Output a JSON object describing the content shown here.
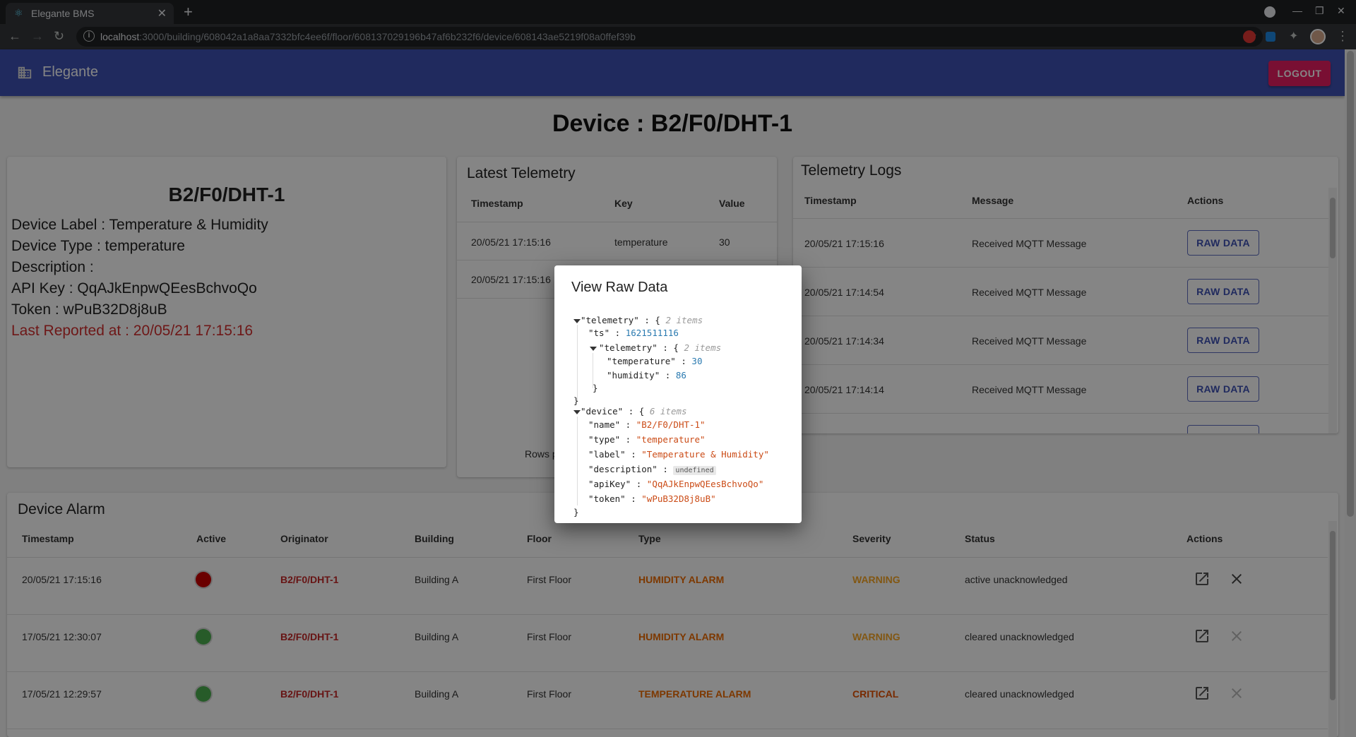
{
  "browser": {
    "tab_title": "Elegante BMS",
    "url_host": "localhost",
    "url_rest": ":3000/building/608042a1a8aa7332bfc4ee6f/floor/608137029196b47af6b232f6/device/608143ae5219f08a0ffef39b"
  },
  "app": {
    "brand": "Elegante",
    "logout_label": "LOGOUT",
    "page_title": "Device : B2/F0/DHT-1"
  },
  "device": {
    "name": "B2/F0/DHT-1",
    "label_line": "Device Label : Temperature & Humidity",
    "type_line": "Device Type : temperature",
    "description_line": "Description :",
    "api_key_line": "API Key : QqAJkEnpwQEesBchvoQo",
    "token_line": "Token : wPuB32D8j8uB",
    "last_reported_line": "Last Reported at : 20/05/21 17:15:16"
  },
  "latest_telemetry": {
    "title": "Latest Telemetry",
    "headers": [
      "Timestamp",
      "Key",
      "Value"
    ],
    "rows": [
      {
        "ts": "20/05/21 17:15:16",
        "key": "temperature",
        "value": "30"
      },
      {
        "ts": "20/05/21 17:15:16",
        "key": "",
        "value": ""
      }
    ],
    "rows_per_page_label": "Rows p"
  },
  "telemetry_logs": {
    "title": "Telemetry Logs",
    "headers": [
      "Timestamp",
      "Message",
      "Actions"
    ],
    "button_label": "RAW DATA",
    "rows": [
      {
        "ts": "20/05/21 17:15:16",
        "msg": "Received MQTT Message"
      },
      {
        "ts": "20/05/21 17:14:54",
        "msg": "Received MQTT Message"
      },
      {
        "ts": "20/05/21 17:14:34",
        "msg": "Received MQTT Message"
      },
      {
        "ts": "20/05/21 17:14:14",
        "msg": "Received MQTT Message"
      }
    ]
  },
  "alarms": {
    "title": "Device Alarm",
    "headers": [
      "Timestamp",
      "Active",
      "Originator",
      "Building",
      "Floor",
      "Type",
      "Severity",
      "Status",
      "Actions"
    ],
    "rows": [
      {
        "ts": "20/05/21 17:15:16",
        "active_color": "#cc0000",
        "originator": "B2/F0/DHT-1",
        "building": "Building A",
        "floor": "First Floor",
        "type": "HUMIDITY ALARM",
        "severity": "WARNING",
        "status": "active unacknowledged"
      },
      {
        "ts": "17/05/21 12:30:07",
        "active_color": "#4caf50",
        "originator": "B2/F0/DHT-1",
        "building": "Building A",
        "floor": "First Floor",
        "type": "HUMIDITY ALARM",
        "severity": "WARNING",
        "status": "cleared unacknowledged"
      },
      {
        "ts": "17/05/21 12:29:57",
        "active_color": "#4caf50",
        "originator": "B2/F0/DHT-1",
        "building": "Building A",
        "floor": "First Floor",
        "type": "TEMPERATURE ALARM",
        "severity": "CRITICAL",
        "status": "cleared unacknowledged"
      }
    ]
  },
  "dialog": {
    "title": "View Raw Data",
    "json": {
      "telemetry_key": "\"telemetry\"",
      "telemetry_count": "2 items",
      "ts_key": "\"ts\"",
      "ts_val": "1621511116",
      "inner_telemetry_key": "\"telemetry\"",
      "inner_count": "2 items",
      "temperature_key": "\"temperature\"",
      "temperature_val": "30",
      "humidity_key": "\"humidity\"",
      "humidity_val": "86",
      "device_key": "\"device\"",
      "device_count": "6 items",
      "name_key": "\"name\"",
      "name_val": "\"B2/F0/DHT-1\"",
      "type_key": "\"type\"",
      "type_val": "\"temperature\"",
      "label_key": "\"label\"",
      "label_val": "\"Temperature & Humidity\"",
      "description_key": "\"description\"",
      "description_val": "undefined",
      "apikey_key": "\"apiKey\"",
      "apikey_val": "\"QqAJkEnpwQEesBchvoQo\"",
      "token_key": "\"token\"",
      "token_val": "\"wPuB32D8j8uB\""
    }
  }
}
